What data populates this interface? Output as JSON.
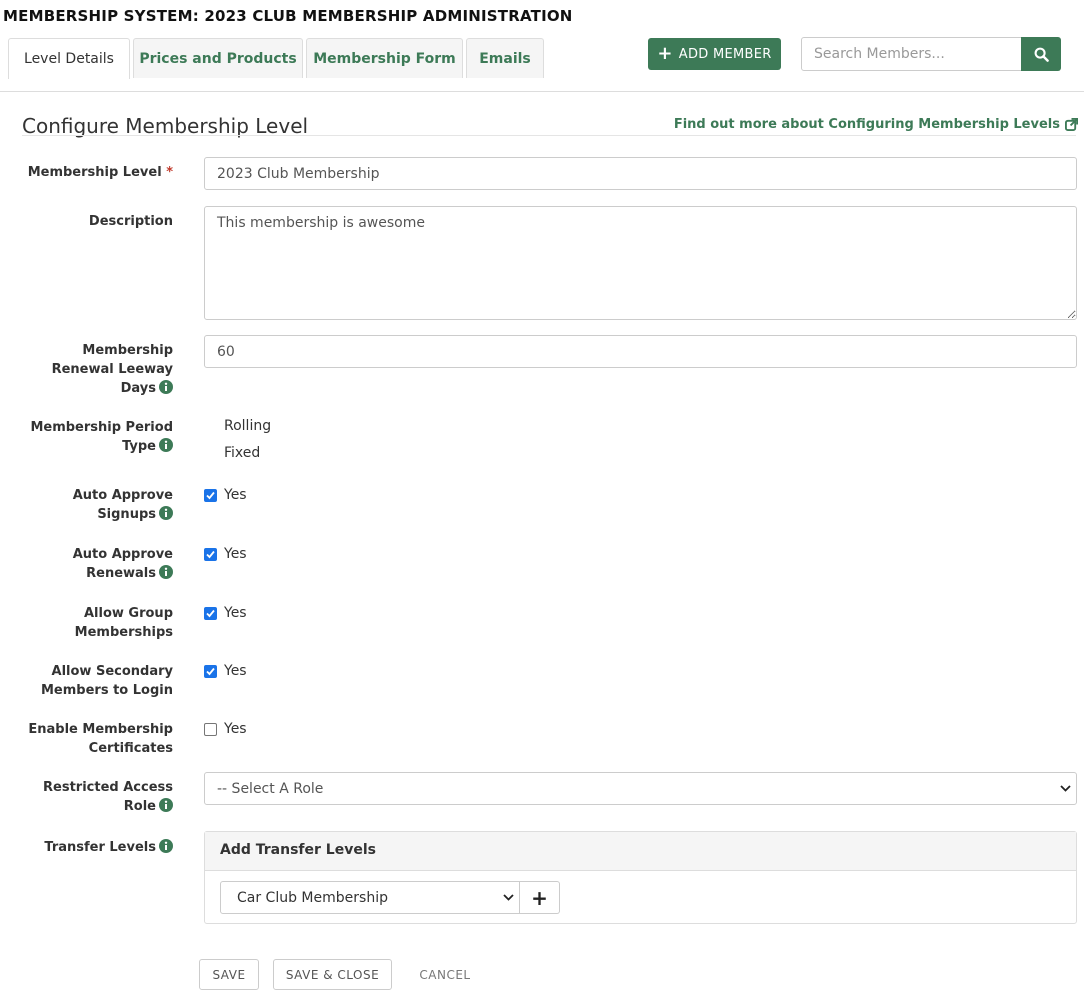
{
  "page": {
    "title": "MEMBERSHIP SYSTEM: 2023 CLUB MEMBERSHIP ADMINISTRATION"
  },
  "tabs": [
    {
      "label": "Level Details",
      "active": true
    },
    {
      "label": "Prices and Products",
      "active": false
    },
    {
      "label": "Membership Form",
      "active": false
    },
    {
      "label": "Emails",
      "active": false
    }
  ],
  "header": {
    "add_member_label": "ADD MEMBER",
    "search_placeholder": "Search Members..."
  },
  "section": {
    "title": "Configure Membership Level",
    "help_link": "Find out more about Configuring Membership Levels"
  },
  "form": {
    "membership_level": {
      "label": "Membership Level",
      "required_mark": "*",
      "value": "2023 Club Membership"
    },
    "description": {
      "label": "Description",
      "value": "This membership is awesome"
    },
    "renewal_leeway": {
      "label_line1": "Membership",
      "label_line2": "Renewal Leeway",
      "label_line3": "Days",
      "value": "60"
    },
    "period_type": {
      "label_line1": "Membership Period",
      "label_line2": "Type",
      "options": [
        "Rolling",
        "Fixed"
      ]
    },
    "auto_approve_signups": {
      "label_line1": "Auto Approve",
      "label_line2": "Signups",
      "checked": true,
      "option_label": "Yes"
    },
    "auto_approve_renewals": {
      "label_line1": "Auto Approve",
      "label_line2": "Renewals",
      "checked": true,
      "option_label": "Yes"
    },
    "allow_group": {
      "label_line1": "Allow Group",
      "label_line2": "Memberships",
      "checked": true,
      "option_label": "Yes"
    },
    "allow_secondary": {
      "label_line1": "Allow Secondary",
      "label_line2": "Members to Login",
      "checked": true,
      "option_label": "Yes"
    },
    "enable_certificates": {
      "label_line1": "Enable Membership",
      "label_line2": "Certificates",
      "checked": false,
      "option_label": "Yes"
    },
    "restricted_role": {
      "label_line1": "Restricted Access",
      "label_line2": "Role",
      "selected": "-- Select A Role"
    },
    "transfer_levels": {
      "label": "Transfer Levels",
      "panel_title": "Add Transfer Levels",
      "selected": "Car Club Membership"
    }
  },
  "actions": {
    "save": "SAVE",
    "save_close": "SAVE & CLOSE",
    "cancel": "CANCEL"
  },
  "colors": {
    "brand_green": "#3d7a57",
    "checkbox_blue": "#1a73e8",
    "required_red": "#c0392b"
  },
  "icons": {
    "info": "info-circle-icon",
    "search": "search-icon",
    "external_link": "external-link-icon",
    "add": "plus-icon",
    "dropdown": "chevron-down-icon"
  }
}
